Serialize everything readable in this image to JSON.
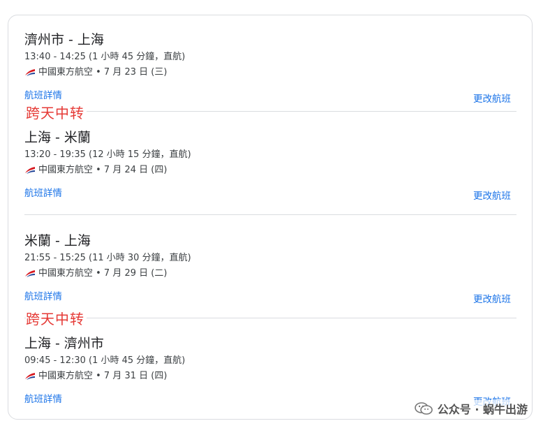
{
  "segments": [
    {
      "route": "濟州市 - 上海",
      "times": "13:40 - 14:25 (1 小時 45 分鐘，直航)",
      "airline": "中國東方航空 • 7 月 23 日 (三)",
      "detail_link": "航班詳情",
      "change_link": "更改航班"
    },
    {
      "route": "上海 - 米蘭",
      "times": "13:20 - 19:35 (12 小時 15 分鐘，直航)",
      "airline": "中國東方航空 • 7 月 24 日 (四)",
      "detail_link": "航班詳情",
      "change_link": "更改航班"
    },
    {
      "route": "米蘭 - 上海",
      "times": "21:55 - 15:25 (11 小時 30 分鐘，直航)",
      "airline": "中國東方航空 • 7 月 29 日 (二)",
      "detail_link": "航班詳情",
      "change_link": "更改航班"
    },
    {
      "route": "上海 - 濟州市",
      "times": "09:45 - 12:30 (1 小時 45 分鐘，直航)",
      "airline": "中國東方航空 • 7 月 31 日 (四)",
      "detail_link": "航班詳情",
      "change_link": "更改航班"
    }
  ],
  "notes": [
    "跨天中转",
    "跨天中转"
  ],
  "watermark": "公众号 · 蜗牛出游",
  "icons": {
    "airline_logo": "china-eastern-logo-icon",
    "watermark_logo": "wechat-icon"
  },
  "colors": {
    "link": "#1a73e8",
    "note": "#e53935",
    "logo_red": "#d71920",
    "logo_blue": "#1c3f94"
  }
}
